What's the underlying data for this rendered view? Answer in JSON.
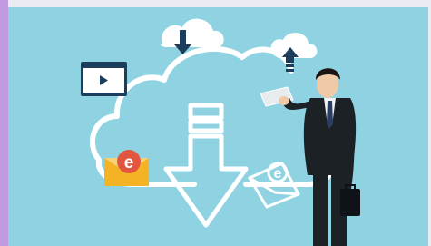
{
  "image": {
    "subject": "",
    "colors": {
      "sky": "#8fd3e3",
      "accent_bar": "#c19ae2",
      "outline": "#ffffff",
      "dark_blue": "#1d3d5c",
      "email_red": "#e2553f",
      "envelope_yellow": "#f4b324",
      "suit": "#1c2126"
    },
    "icons": [
      "cloud-icon",
      "download-arrow-icon",
      "upload-arrow-icon",
      "video-player-icon",
      "email-envelope-icon",
      "download-big-arrow-icon",
      "tablet-icon",
      "briefcase-icon"
    ]
  }
}
